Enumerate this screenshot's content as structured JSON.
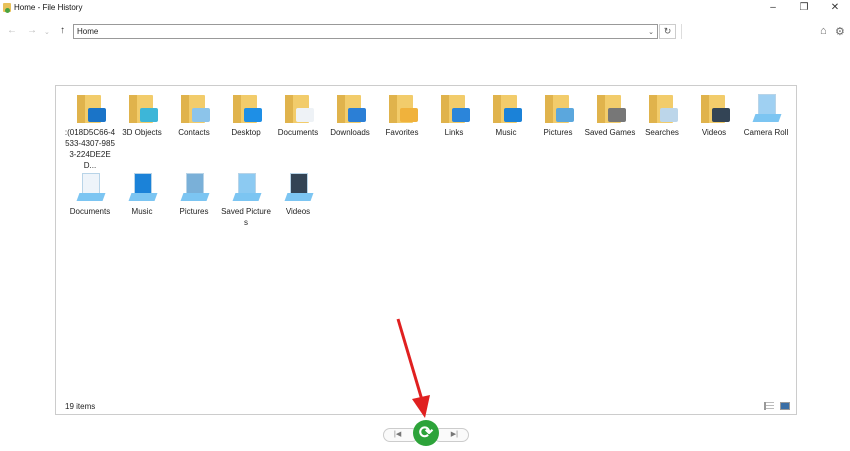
{
  "window": {
    "title": "Home - File History"
  },
  "address": {
    "value": "Home"
  },
  "status": {
    "count": "19 items"
  },
  "items": [
    {
      "label": ":(018D5C66-4533-4307-9853-224DE2ED...",
      "kind": "folder",
      "overlay": "#1a74c8"
    },
    {
      "label": "3D Objects",
      "kind": "folder",
      "overlay": "#3db6d8"
    },
    {
      "label": "Contacts",
      "kind": "folder",
      "overlay": "#8cc4ea"
    },
    {
      "label": "Desktop",
      "kind": "folder",
      "overlay": "#1e8fe6"
    },
    {
      "label": "Documents",
      "kind": "folder",
      "overlay": "#eef2f6"
    },
    {
      "label": "Downloads",
      "kind": "folder",
      "overlay": "#2b7fd6"
    },
    {
      "label": "Favorites",
      "kind": "folder",
      "overlay": "#f0b23c"
    },
    {
      "label": "Links",
      "kind": "folder",
      "overlay": "#2b85da"
    },
    {
      "label": "Music",
      "kind": "folder",
      "overlay": "#1b82d8"
    },
    {
      "label": "Pictures",
      "kind": "folder",
      "overlay": "#5ba7dd"
    },
    {
      "label": "Saved Games",
      "kind": "folder",
      "overlay": "#777777"
    },
    {
      "label": "Searches",
      "kind": "folder",
      "overlay": "#bcd6ea"
    },
    {
      "label": "Videos",
      "kind": "folder",
      "overlay": "#334455"
    },
    {
      "label": "Camera Roll",
      "kind": "library",
      "overlay": "#9fd0f2"
    },
    {
      "label": "Documents",
      "kind": "library",
      "overlay": "#eef4fa"
    },
    {
      "label": "Music",
      "kind": "library",
      "overlay": "#1b82d8"
    },
    {
      "label": "Pictures",
      "kind": "library",
      "overlay": "#7ab0d8"
    },
    {
      "label": "Saved Pictures",
      "kind": "library",
      "overlay": "#8ccaf2"
    },
    {
      "label": "Videos",
      "kind": "library",
      "overlay": "#334455"
    }
  ]
}
